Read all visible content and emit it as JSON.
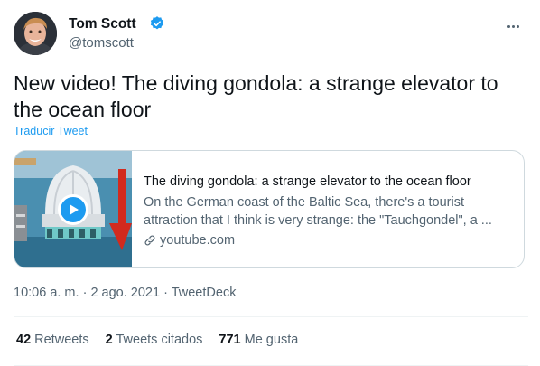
{
  "author": {
    "name": "Tom Scott",
    "handle": "@tomscott",
    "verified": true
  },
  "tweet": {
    "text": "New video! The diving gondola: a strange elevator to the ocean floor",
    "translate_label": "Traducir Tweet"
  },
  "card": {
    "title": "The diving gondola: a strange elevator to the ocean floor",
    "description": "On the German coast of the Baltic Sea, there's a tourist attraction that I think is very strange: the \"Tauchgondel\", a ...",
    "domain": "youtube.com"
  },
  "meta": {
    "time": "10:06 a. m.",
    "separator": "·",
    "date": "2 ago. 2021",
    "client": "TweetDeck"
  },
  "stats": {
    "retweets_count": "42",
    "retweets_label": "Retweets",
    "quotes_count": "2",
    "quotes_label": "Tweets citados",
    "likes_count": "771",
    "likes_label": "Me gusta"
  },
  "colors": {
    "accent": "#1d9bf0",
    "text": "#0f1419",
    "secondary": "#536471",
    "border": "#cfd9de"
  }
}
